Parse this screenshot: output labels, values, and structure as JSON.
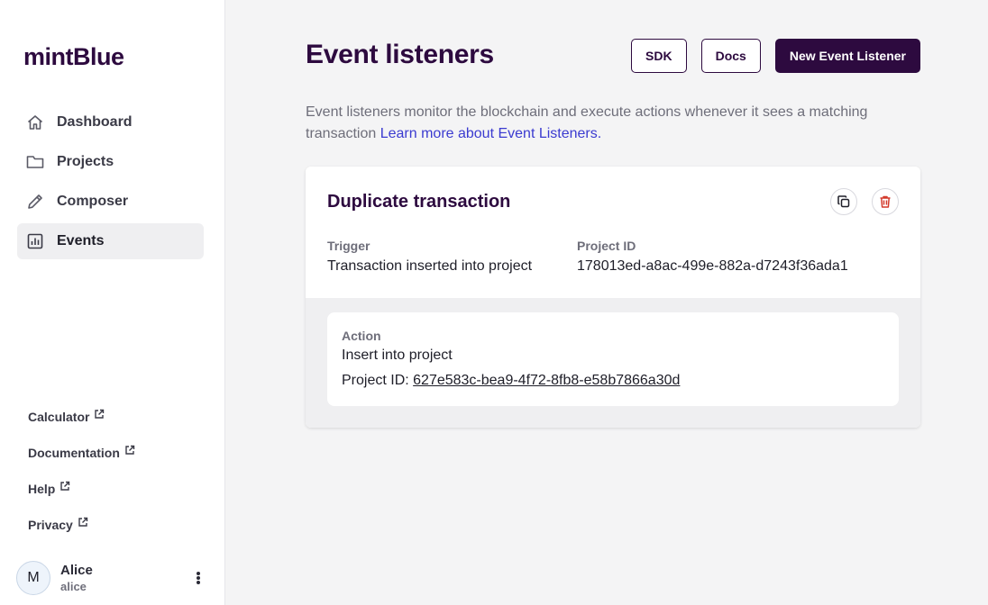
{
  "app": {
    "logo": "mintBlue"
  },
  "sidebar": {
    "nav": [
      {
        "label": "Dashboard",
        "icon": "home-icon",
        "active": false
      },
      {
        "label": "Projects",
        "icon": "folder-icon",
        "active": false
      },
      {
        "label": "Composer",
        "icon": "pencil-icon",
        "active": false
      },
      {
        "label": "Events",
        "icon": "chart-icon",
        "active": true
      }
    ],
    "external_links": [
      {
        "label": "Calculator",
        "icon": "external-link-icon"
      },
      {
        "label": "Documentation",
        "icon": "external-link-icon"
      },
      {
        "label": "Help",
        "icon": "external-link-icon"
      },
      {
        "label": "Privacy",
        "icon": "external-link-icon"
      }
    ],
    "user": {
      "initial": "M",
      "name": "Alice",
      "handle": "alice",
      "menu_icon": "kebab-menu-icon"
    }
  },
  "header": {
    "title": "Event listeners",
    "buttons": {
      "sdk": "SDK",
      "docs": "Docs",
      "new": "New Event Listener"
    }
  },
  "description": {
    "text": "Event listeners monitor the blockchain and execute actions whenever it sees a matching transaction",
    "link": "Learn more about Event Listeners."
  },
  "listener": {
    "title": "Duplicate transaction",
    "copy_icon": "copy-icon",
    "delete_icon": "trash-icon",
    "trigger_label": "Trigger",
    "trigger_value": "Transaction inserted into project",
    "project_id_label": "Project ID",
    "project_id_value": "178013ed-a8ac-499e-882a-d7243f36ada1",
    "action": {
      "label": "Action",
      "type": "Insert into project",
      "project_id_prefix": "Project ID:",
      "project_id_value": "627e583c-bea9-4f72-8fb8-e58b7866a30d"
    }
  },
  "colors": {
    "brand": "#2d0a3f",
    "link": "#3b3bd0",
    "delete": "#d33a2c",
    "sidebar_active": "#efeff1",
    "background": "#f4f4f5"
  }
}
